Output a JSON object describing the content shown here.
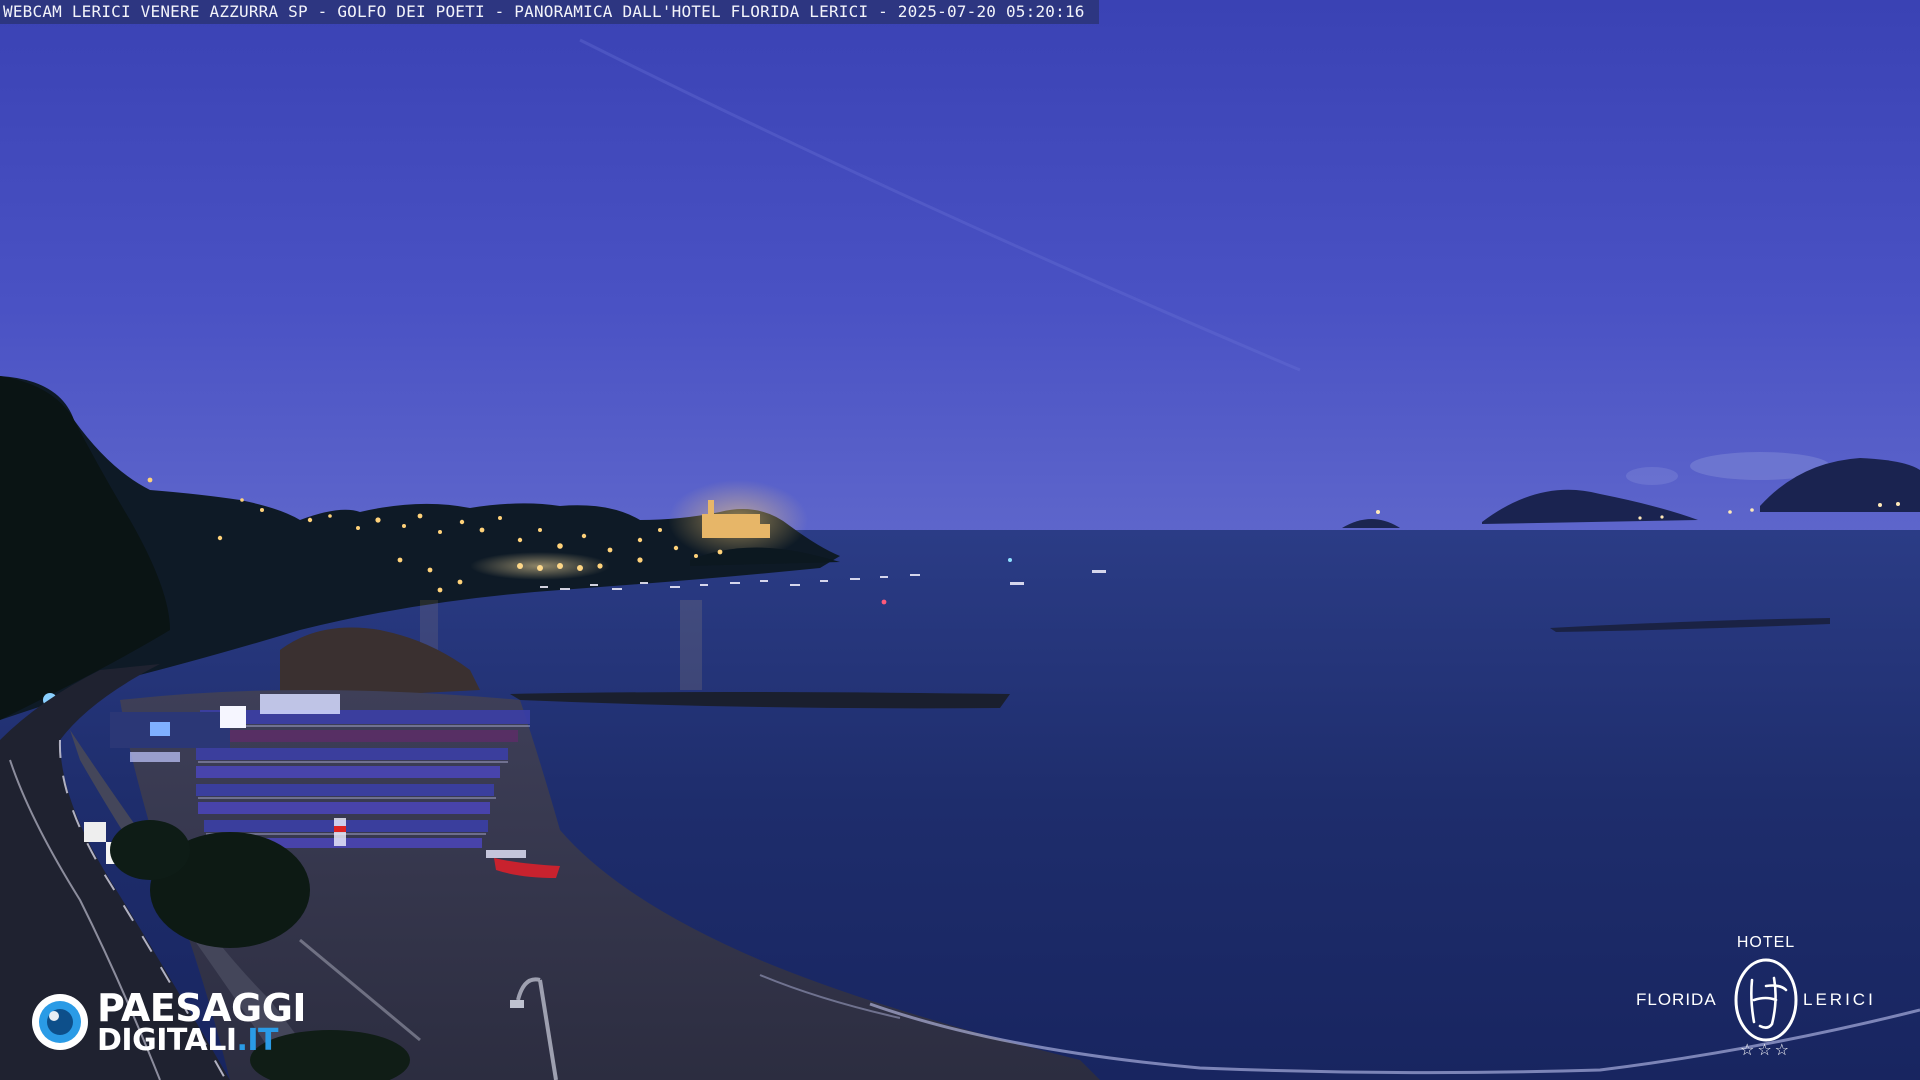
{
  "caption": {
    "text": "WEBCAM LERICI VENERE AZZURRA SP - GOLFO DEI POETI - PANORAMICA DALL'HOTEL FLORIDA LERICI - 2025-07-20 05:20:16"
  },
  "watermark_left": {
    "line1": "PAESAGGI",
    "line2_main": "DIGITALI",
    "line2_tld": ".IT",
    "icon": "eye-icon"
  },
  "watermark_right": {
    "top": "HOTEL",
    "left": "FLORIDA",
    "right": "LERICI",
    "monogram": "HF",
    "stars": "☆☆☆"
  },
  "colors": {
    "sky_top": "#3b45b6",
    "sky_horizon": "#5a63cc",
    "sea": "#1f2e6e",
    "hills": "#0d1a22",
    "city_light": "#ffd27a",
    "brand_blue": "#2a9be6"
  }
}
